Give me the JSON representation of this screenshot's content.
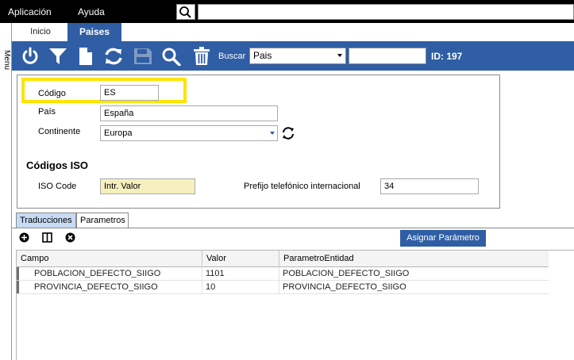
{
  "menubar": {
    "items": [
      "Aplicación",
      "Ayuda"
    ],
    "search_value": ""
  },
  "side_menu": {
    "label": "Menu"
  },
  "tabs": [
    {
      "label": "Inicio",
      "active": false
    },
    {
      "label": "Paises",
      "active": true
    }
  ],
  "toolbar": {
    "icons": [
      "power-icon",
      "filter-icon",
      "new-document-icon",
      "refresh-icon",
      "save-icon",
      "search-icon",
      "delete-icon"
    ],
    "search_label": "Buscar",
    "search_field": "Pais",
    "search_value": "",
    "id_text": "ID: 197",
    "accent_color": "#2f5ea4"
  },
  "form": {
    "codigo_label": "Código",
    "codigo_value": "ES",
    "pais_label": "País",
    "pais_value": "España",
    "continente_label": "Continente",
    "continente_value": "Europa",
    "iso_section_title": "Códigos ISO",
    "iso_code_label": "ISO Code",
    "iso_code_value": "Intr. Valor",
    "prefijo_label": "Prefijo telefónico internacional",
    "prefijo_value": "34",
    "highlight_color": "#ffe400"
  },
  "bottom_tabs": [
    {
      "label": "Traducciones",
      "active": false
    },
    {
      "label": "Parametros",
      "active": true
    }
  ],
  "grid": {
    "toolbar_icons": [
      "add-icon",
      "columns-icon",
      "remove-icon"
    ],
    "assign_button_label": "Asignar Parámetro",
    "columns": [
      "Campo",
      "Valor",
      "ParametroEntidad"
    ],
    "rows": [
      {
        "campo": "POBLACION_DEFECTO_SIIGO",
        "valor": "1101",
        "entidad": "POBLACION_DEFECTO_SIIGO"
      },
      {
        "campo": "PROVINCIA_DEFECTO_SIIGO",
        "valor": "10",
        "entidad": "PROVINCIA_DEFECTO_SIIGO"
      }
    ]
  }
}
